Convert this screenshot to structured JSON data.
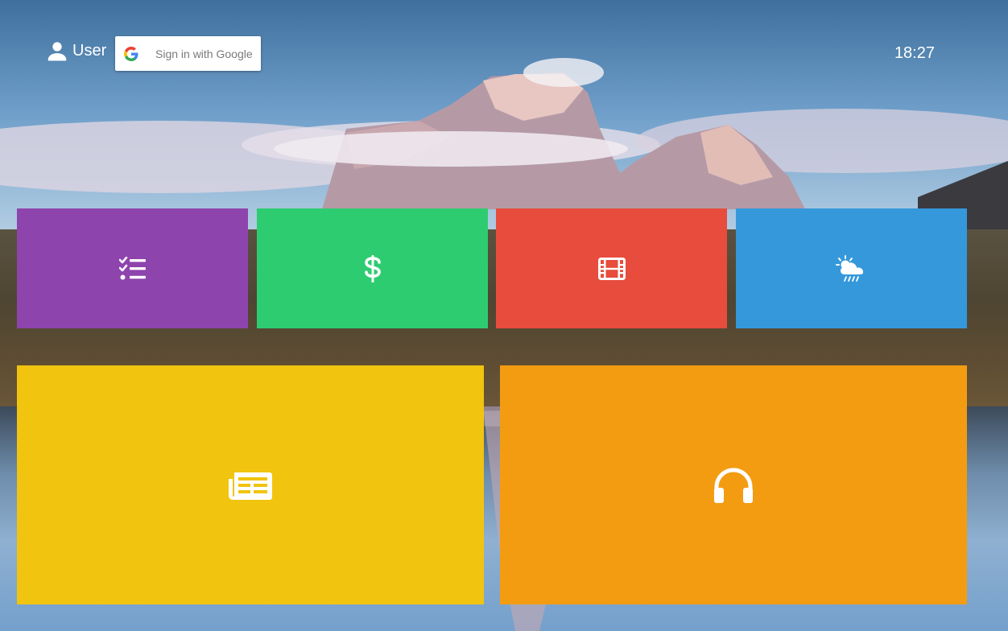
{
  "header": {
    "user_label": "User",
    "google_button_label": "Sign in with Google",
    "clock": "18:27"
  },
  "tiles": [
    {
      "id": "todo",
      "icon": "checklist-icon",
      "color": "#8e44ad"
    },
    {
      "id": "finance",
      "icon": "dollar-icon",
      "color": "#2ecc71"
    },
    {
      "id": "movies",
      "icon": "film-icon",
      "color": "#e74c3c"
    },
    {
      "id": "weather",
      "icon": "weather-icon",
      "color": "#3498db"
    },
    {
      "id": "news",
      "icon": "newspaper-icon",
      "color": "#f1c40f"
    },
    {
      "id": "music",
      "icon": "headphones-icon",
      "color": "#f39c12"
    }
  ]
}
